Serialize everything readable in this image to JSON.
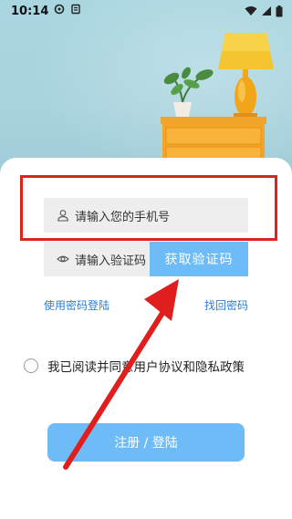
{
  "status_bar": {
    "time": "10:14",
    "left_icons": [
      "gear-icon",
      "notification-icon"
    ],
    "right_icons": [
      "wifi-icon",
      "signal-icon",
      "battery-icon"
    ]
  },
  "login": {
    "phone_placeholder": "请输入您的手机号",
    "code_placeholder": "请输入验证码",
    "get_code_label": "获取验证码",
    "password_login_link": "使用密码登陆",
    "forgot_password_link": "找回密码",
    "agreement_text": "我已阅读并同意用户协议和隐私政策",
    "submit_label": "注册 / 登陆"
  },
  "colors": {
    "accent": "#6ebcf7",
    "link": "#2d7fd0",
    "annotation": "#d9251d",
    "input_bg": "#eeeeee"
  },
  "icons": {
    "phone_field": "user-icon",
    "code_field": "eye-icon"
  }
}
